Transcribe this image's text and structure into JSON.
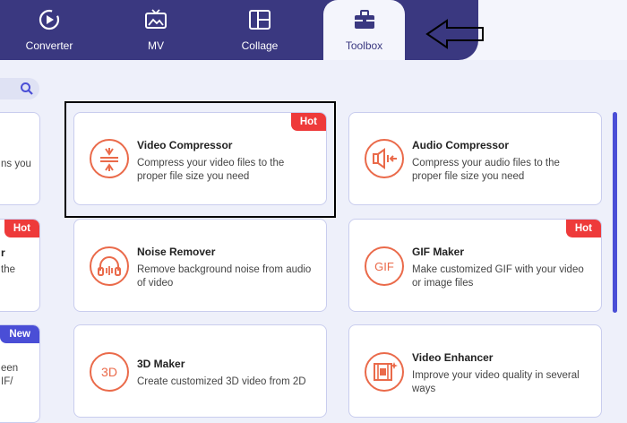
{
  "nav": {
    "tabs": [
      {
        "label": "Converter",
        "icon": "converter-icon"
      },
      {
        "label": "MV",
        "icon": "mv-icon"
      },
      {
        "label": "Collage",
        "icon": "collage-icon"
      },
      {
        "label": "Toolbox",
        "icon": "toolbox-icon",
        "active": true
      }
    ]
  },
  "search": {
    "icon": "search-icon"
  },
  "tools": [
    {
      "title": "Video Compressor",
      "desc": "Compress your video files to the proper file size you need",
      "badge": "Hot",
      "icon": "video-compressor-icon"
    },
    {
      "title": "Audio Compressor",
      "desc": "Compress your audio files to the proper file size you need",
      "badge": "",
      "icon": "audio-compressor-icon"
    },
    {
      "title": "Noise Remover",
      "desc": "Remove background noise from audio of video",
      "badge": "",
      "icon": "noise-remover-icon"
    },
    {
      "title": "GIF Maker",
      "desc": "Make customized GIF with your video or image files",
      "badge": "Hot",
      "icon": "gif-icon"
    },
    {
      "title": "3D Maker",
      "desc": "Create customized 3D video from 2D",
      "badge": "",
      "icon": "3d-icon"
    },
    {
      "title": "Video Enhancer",
      "desc": "Improve your video quality in several ways",
      "badge": "",
      "icon": "video-enhancer-icon"
    }
  ],
  "partial_cards": [
    {
      "lines": [
        "ns you"
      ],
      "badge": ""
    },
    {
      "title_frag": "r",
      "lines": [
        "the"
      ],
      "badge": "Hot"
    },
    {
      "lines": [
        "een",
        "IF/"
      ],
      "badge": "New"
    }
  ],
  "colors": {
    "nav_bg": "#3a3880",
    "accent": "#ea6a4a",
    "hot": "#ee3a3a",
    "new": "#4a4ed6"
  }
}
